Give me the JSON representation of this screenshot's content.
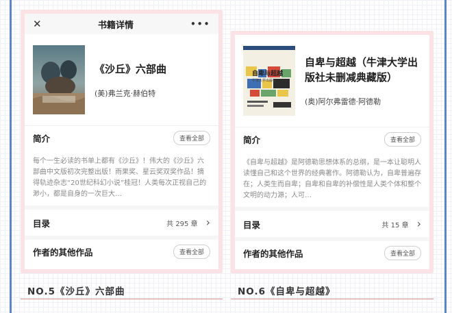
{
  "left": {
    "topbar": {
      "title": "书籍详情",
      "close_icon": "close-icon",
      "more_icon": "more-icon",
      "more_glyph": "•••"
    },
    "book": {
      "title": "《沙丘》六部曲",
      "author": "(美)弗兰克·赫伯特"
    },
    "intro": {
      "heading": "简介",
      "button": "查看全部",
      "text": "每个一生必读的书单上都有《沙丘》！伟大的《沙丘》六部曲中文版初次完整出版！雨果奖、星云奖双奖作品！摘得轨迹杂志“20世纪科幻小说”桂冠！人类每次正视自己的渺小，都是自身的一次巨大…"
    },
    "toc": {
      "heading": "目录",
      "count": "共 295 章"
    },
    "other": {
      "heading": "作者的其他作品",
      "button": "查看全部"
    },
    "caption": "NO.5《沙丘》六部曲"
  },
  "right": {
    "book": {
      "title": "自卑与超越（牛津大学出版社未删减典藏版）",
      "author": "(奥)阿尔弗雷德·阿德勒",
      "cover_title": "自卑与超越",
      "cover_subtitle": "牛津大学出版社"
    },
    "intro": {
      "heading": "简介",
      "button": "查看全部",
      "text": "《自卑与超越》是阿德勒思想体系的总纲，是一本让聪明人读懂自己和这个世界的经典著作。阿德勒认为，自卑普遍存在；人类生而自卑；自卑和自卑的补偿性是人类个体和整个文明的动力源；人可…"
    },
    "toc": {
      "heading": "目录",
      "count": "共 15 章"
    },
    "other": {
      "heading": "作者的其他作品",
      "button": "查看全部"
    },
    "caption": "NO.6《自卑与超越》"
  },
  "colors": {
    "frame": "#fbe3e5",
    "side_line": "#5d83c8",
    "caption_line": "#d88a8a"
  }
}
